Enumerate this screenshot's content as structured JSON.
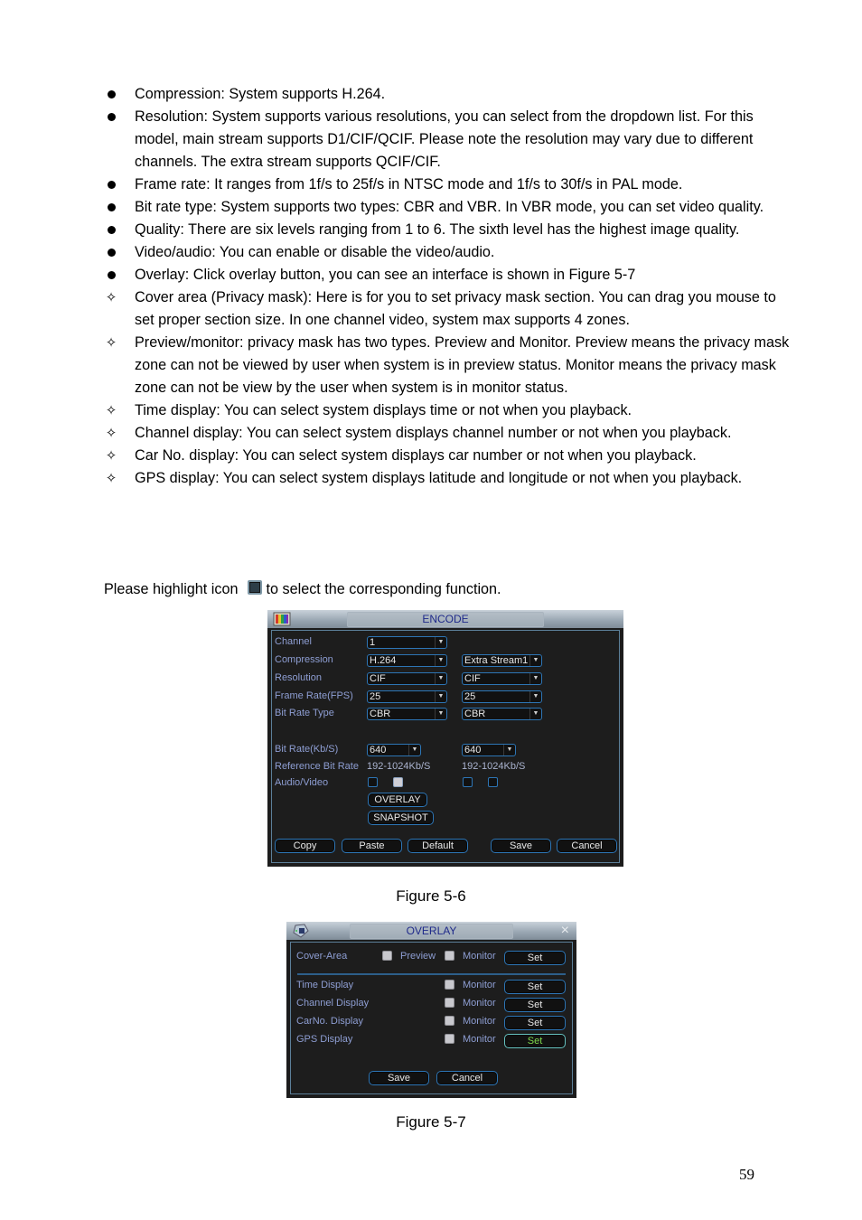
{
  "bullets": [
    {
      "marker": "dot",
      "text": "Compression: System supports H.264."
    },
    {
      "marker": "dot",
      "text": "Resolution: System supports various resolutions, you can select from the dropdown list. For this model, main stream supports D1/CIF/QCIF. Please note the resolution may vary due to different channels. The extra stream supports QCIF/CIF."
    },
    {
      "marker": "dot",
      "text": "Frame rate: It ranges from 1f/s to 25f/s in NTSC mode and 1f/s to 30f/s in PAL mode."
    },
    {
      "marker": "dot",
      "text": "Bit rate type: System supports two types: CBR and VBR. In VBR mode, you can set video quality."
    },
    {
      "marker": "dot",
      "text": "Quality: There are six levels ranging from 1 to 6. The sixth level has the highest image quality."
    },
    {
      "marker": "dot",
      "text": "Video/audio: You can enable or disable the video/audio."
    },
    {
      "marker": "dot",
      "text": "Overlay: Click overlay button, you can see an interface is shown in Figure 5-7"
    },
    {
      "marker": "diamond",
      "text": "Cover area (Privacy mask): Here is for you to set privacy mask section. You can drag you mouse to set proper section size. In one channel video, system max supports 4 zones."
    },
    {
      "marker": "diamond",
      "text": "Preview/monitor: privacy mask has two types. Preview and Monitor. Preview means the privacy mask zone can not be viewed by user when system is in preview status. Monitor means the privacy mask zone can not be view by the user when system is in monitor status."
    },
    {
      "marker": "diamond",
      "text": "Time display: You can select system displays time or not when you playback."
    },
    {
      "marker": "diamond",
      "text": "Channel display: You can select system displays channel number or not when you playback."
    },
    {
      "marker": "diamond",
      "text": "Car No. display: You can select system displays car number or not when you playback."
    },
    {
      "marker": "diamond",
      "text": "GPS display: You can select system displays latitude and longitude or not when you playback."
    }
  ],
  "highlight_note": {
    "before": "Please highlight icon",
    "after": "to select the corresponding function.",
    "icon": "checkbox-square-icon"
  },
  "encode": {
    "title": "ENCODE",
    "labels": {
      "channel": "Channel",
      "compression": "Compression",
      "resolution": "Resolution",
      "frame_rate": "Frame Rate(FPS)",
      "bit_rate_type": "Bit Rate Type",
      "bit_rate": "Bit Rate(Kb/S)",
      "reference_bit_rate": "Reference Bit Rate",
      "audio_video": "Audio/Video"
    },
    "main": {
      "channel": "1",
      "compression": "H.264",
      "resolution": "CIF",
      "frame_rate": "25",
      "bit_rate_type": "CBR",
      "bit_rate": "640",
      "reference_bit_rate": "192-1024Kb/S",
      "audio_checked": false,
      "video_checked": true
    },
    "extra": {
      "stream": "Extra Stream1",
      "resolution": "CIF",
      "frame_rate": "25",
      "bit_rate_type": "CBR",
      "bit_rate": "640",
      "reference_bit_rate": "192-1024Kb/S",
      "audio_checked": false,
      "video_checked": false
    },
    "buttons": {
      "overlay": "OVERLAY",
      "snapshot": "SNAPSHOT",
      "copy": "Copy",
      "paste": "Paste",
      "default": "Default",
      "save": "Save",
      "cancel": "Cancel"
    }
  },
  "caption1": "Figure 5-6",
  "overlay": {
    "title": "OVERLAY",
    "close": "×",
    "cover_area": {
      "label": "Cover-Area",
      "preview": "Preview",
      "monitor": "Monitor",
      "set": "Set"
    },
    "rows": [
      {
        "label": "Time Display",
        "monitor": "Monitor",
        "set": "Set",
        "active": false
      },
      {
        "label": "Channel Display",
        "monitor": "Monitor",
        "set": "Set",
        "active": false
      },
      {
        "label": "CarNo. Display",
        "monitor": "Monitor",
        "set": "Set",
        "active": false
      },
      {
        "label": "GPS Display",
        "monitor": "Monitor",
        "set": "Set",
        "active": true
      }
    ],
    "buttons": {
      "save": "Save",
      "cancel": "Cancel"
    },
    "colors": {
      "active_set_text": "#7fd84d",
      "label_text": "#8e9ed3"
    }
  },
  "caption2": "Figure 5-7",
  "page_number": "59"
}
